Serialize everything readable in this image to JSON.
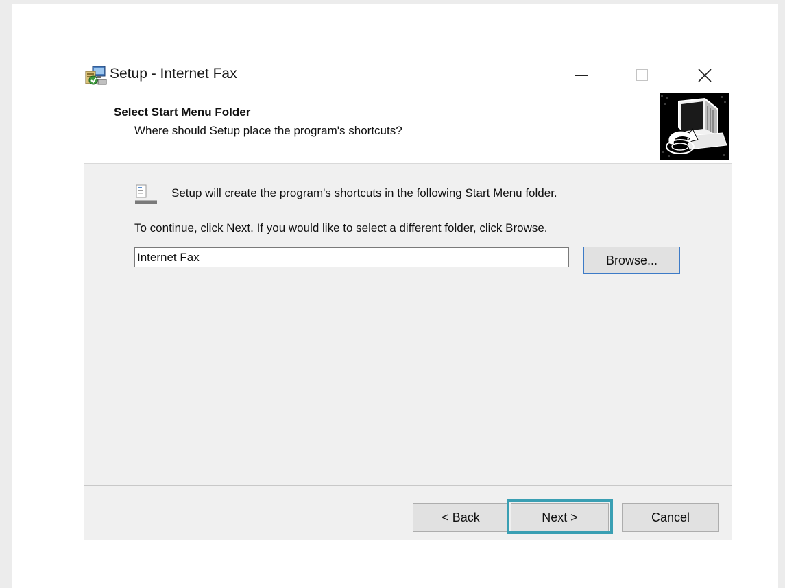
{
  "window": {
    "title": "Setup - Internet Fax",
    "icon": "setup-installer-icon",
    "controls": {
      "minimize": "minimize-icon",
      "maximize": "maximize-icon",
      "close": "close-icon"
    }
  },
  "header": {
    "title": "Select Start Menu Folder",
    "subtitle": "Where should Setup place the program's shortcuts?",
    "image": "computer-install-icon"
  },
  "body": {
    "info_icon": "start-menu-folder-icon",
    "info_text": "Setup will create the program's shortcuts in the following Start Menu folder.",
    "instruction_text": "To continue, click Next. If you would like to select a different folder, click Browse.",
    "folder_input": {
      "value": "Internet Fax",
      "placeholder": ""
    },
    "browse_label": "Browse..."
  },
  "footer": {
    "back_label": "< Back",
    "next_label": "Next >",
    "cancel_label": "Cancel"
  },
  "colors": {
    "highlight": "#3a9fb3",
    "panel": "#f0f0f0",
    "button": "#e1e1e1",
    "focus_border": "#3d7bc7"
  }
}
